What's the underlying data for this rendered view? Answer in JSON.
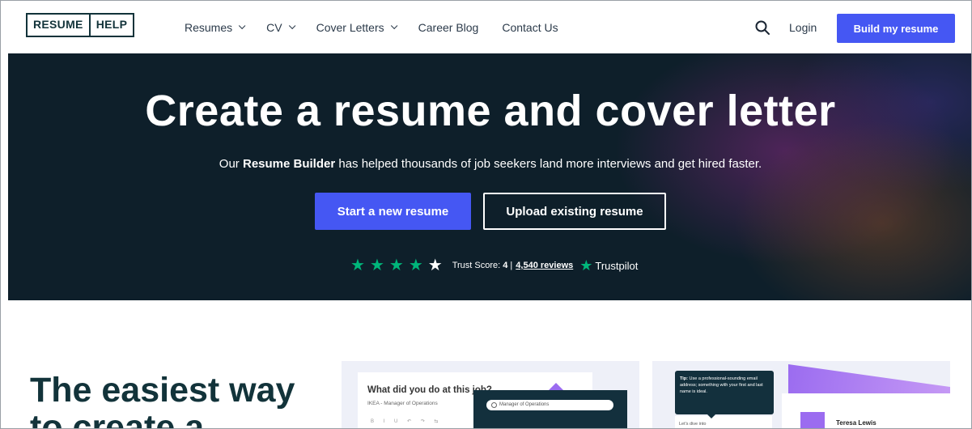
{
  "header": {
    "logo": {
      "part1": "RESUME",
      "part2": "HELP"
    },
    "nav": [
      {
        "label": "Resumes",
        "dropdown": true
      },
      {
        "label": "CV",
        "dropdown": true
      },
      {
        "label": "Cover Letters",
        "dropdown": true
      },
      {
        "label": "Career Blog",
        "dropdown": false
      },
      {
        "label": "Contact Us",
        "dropdown": false
      }
    ],
    "search_icon": "search-icon",
    "login_label": "Login",
    "cta_label": "Build my resume"
  },
  "hero": {
    "title": "Create a resume and cover letter",
    "sub_pre": "Our ",
    "sub_bold": "Resume Builder",
    "sub_post": " has helped thousands of job seekers land more interviews and get hired faster.",
    "start_label": "Start a new resume",
    "upload_label": "Upload existing resume",
    "trust": {
      "stars_filled": 4,
      "stars_total": 5,
      "score_label": "Trust Score: ",
      "score": "4",
      "sep": " | ",
      "reviews": "4,540 reviews",
      "brand": "Trustpilot"
    }
  },
  "section": {
    "title_line1": "The easiest way",
    "title_line2": "to create a"
  },
  "card1": {
    "question": "What did you do at this job?",
    "subtitle": "IKEA - Manager of Operations",
    "tools": "B I U ↶ ↷ ⇆",
    "search_text": "Manager of Operations"
  },
  "card2": {
    "tip_bold": "Tip:",
    "tip_text": " Use a professional-sounding email address; something with your first and last name is ideal.",
    "dive_text": "Let's dive into",
    "name": "Teresa Lewis"
  },
  "colors": {
    "accent": "#4557f3",
    "hero_bg": "#0e1f2a",
    "trustpilot_green": "#00b67a",
    "brand_dark": "#12333a"
  }
}
